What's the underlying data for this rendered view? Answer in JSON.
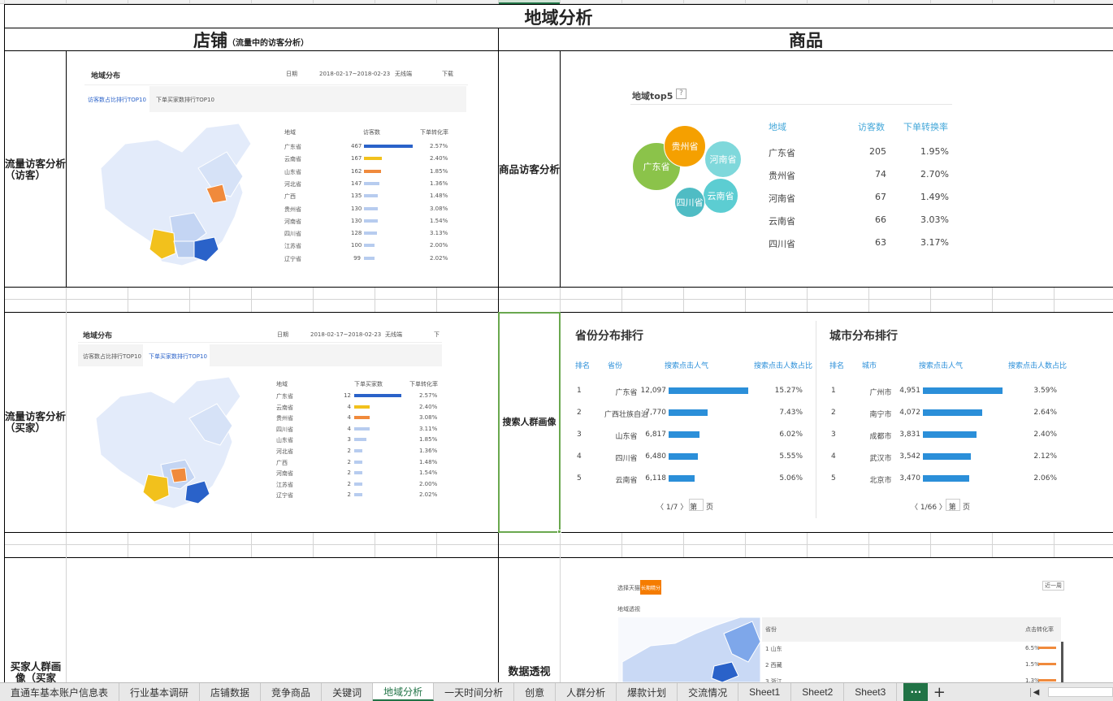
{
  "title": "地域分析",
  "headers": {
    "shop": "店铺",
    "shop_note": "（流量中的访客分析）",
    "product": "商品"
  },
  "row_labels": {
    "r1": "流量访客分析（访客）",
    "r2": "流量访客分析（买家）",
    "r3": "买家人群画像（买家",
    "p1": "商品访客分析",
    "p2": "搜索人群画像",
    "p3": "数据透视"
  },
  "shot1": {
    "title": "地域分布",
    "date_label": "日期",
    "date_range": "2018-02-17~2018-02-23",
    "device": "无线端",
    "download": "下载",
    "tabs": [
      "访客数占比排行TOP10",
      "下单买家数排行TOP10"
    ],
    "cols": [
      "地域",
      "访客数",
      "下单转化率"
    ],
    "rows": [
      {
        "name": "广东省",
        "v": "467",
        "r": "2.57%",
        "w": 1.0,
        "c": "#2a62c9"
      },
      {
        "name": "云南省",
        "v": "167",
        "r": "2.40%",
        "w": 0.36,
        "c": "#f2c11c"
      },
      {
        "name": "山东省",
        "v": "162",
        "r": "1.85%",
        "w": 0.35,
        "c": "#f08a3c"
      },
      {
        "name": "河北省",
        "v": "147",
        "r": "1.36%",
        "w": 0.31,
        "c": "#b7ccef"
      },
      {
        "name": "广西",
        "v": "135",
        "r": "1.48%",
        "w": 0.29,
        "c": "#b7ccef"
      },
      {
        "name": "贵州省",
        "v": "130",
        "r": "3.08%",
        "w": 0.28,
        "c": "#b7ccef"
      },
      {
        "name": "河南省",
        "v": "130",
        "r": "1.54%",
        "w": 0.28,
        "c": "#b7ccef"
      },
      {
        "name": "四川省",
        "v": "128",
        "r": "3.13%",
        "w": 0.27,
        "c": "#b7ccef"
      },
      {
        "name": "江苏省",
        "v": "100",
        "r": "2.00%",
        "w": 0.21,
        "c": "#b7ccef"
      },
      {
        "name": "辽宁省",
        "v": "99",
        "r": "2.02%",
        "w": 0.21,
        "c": "#b7ccef"
      }
    ]
  },
  "shot2": {
    "title": "地域分布",
    "date_label": "日期",
    "date_range": "2018-02-17~2018-02-23",
    "device": "无线端",
    "download": "下",
    "tabs": [
      "访客数占比排行TOP10",
      "下单买家数排行TOP10"
    ],
    "cols": [
      "地域",
      "下单买家数",
      "下单转化率"
    ],
    "rows": [
      {
        "name": "广东省",
        "v": "12",
        "r": "2.57%",
        "w": 1.0,
        "c": "#2a62c9"
      },
      {
        "name": "云南省",
        "v": "4",
        "r": "2.40%",
        "w": 0.33,
        "c": "#f2c11c"
      },
      {
        "name": "贵州省",
        "v": "4",
        "r": "3.08%",
        "w": 0.33,
        "c": "#f08a3c"
      },
      {
        "name": "四川省",
        "v": "4",
        "r": "3.11%",
        "w": 0.33,
        "c": "#b7ccef"
      },
      {
        "name": "山东省",
        "v": "3",
        "r": "1.85%",
        "w": 0.25,
        "c": "#b7ccef"
      },
      {
        "name": "河北省",
        "v": "2",
        "r": "1.36%",
        "w": 0.17,
        "c": "#b7ccef"
      },
      {
        "name": "广西",
        "v": "2",
        "r": "1.48%",
        "w": 0.17,
        "c": "#b7ccef"
      },
      {
        "name": "河南省",
        "v": "2",
        "r": "1.54%",
        "w": 0.17,
        "c": "#b7ccef"
      },
      {
        "name": "江苏省",
        "v": "2",
        "r": "2.00%",
        "w": 0.17,
        "c": "#b7ccef"
      },
      {
        "name": "辽宁省",
        "v": "2",
        "r": "2.02%",
        "w": 0.17,
        "c": "#b7ccef"
      }
    ]
  },
  "top5": {
    "title": "地域top5",
    "help": "?",
    "cols": [
      "地域",
      "访客数",
      "下单转换率"
    ],
    "rows": [
      {
        "name": "广东省",
        "v": "205",
        "r": "1.95%",
        "c": "#8bc34a"
      },
      {
        "name": "贵州省",
        "v": "74",
        "r": "2.70%",
        "c": "#f5a000"
      },
      {
        "name": "河南省",
        "v": "67",
        "r": "1.49%",
        "c": "#7fd8db"
      },
      {
        "name": "云南省",
        "v": "66",
        "r": "3.03%",
        "c": "#5ccdd2"
      },
      {
        "name": "四川省",
        "v": "63",
        "r": "3.17%",
        "c": "#4fbcc4"
      }
    ]
  },
  "province_rank": {
    "title": "省份分布排行",
    "cols": [
      "排名",
      "省份",
      "搜索点击人气",
      "搜索点击人数占比"
    ],
    "rows": [
      {
        "rank": "1",
        "name": "广东省",
        "v": "12,097",
        "p": "15.27%",
        "w": 1.0
      },
      {
        "rank": "2",
        "name": "广西壮族自治",
        "v": "7,770",
        "p": "7.43%",
        "w": 0.49
      },
      {
        "rank": "3",
        "name": "山东省",
        "v": "6,817",
        "p": "6.02%",
        "w": 0.39
      },
      {
        "rank": "4",
        "name": "四川省",
        "v": "6,480",
        "p": "5.55%",
        "w": 0.37
      },
      {
        "rank": "5",
        "name": "云南省",
        "v": "6,118",
        "p": "5.06%",
        "w": 0.33
      }
    ],
    "pager": "〈 1/7 〉 第",
    "page_suffix": "页"
  },
  "city_rank": {
    "title": "城市分布排行",
    "cols": [
      "排名",
      "城市",
      "搜索点击人气",
      "搜索点击人数占比"
    ],
    "rows": [
      {
        "rank": "1",
        "name": "广州市",
        "v": "4,951",
        "p": "3.59%",
        "w": 1.0
      },
      {
        "rank": "2",
        "name": "南宁市",
        "v": "4,072",
        "p": "2.64%",
        "w": 0.74
      },
      {
        "rank": "3",
        "name": "成都市",
        "v": "3,831",
        "p": "2.40%",
        "w": 0.67
      },
      {
        "rank": "4",
        "name": "武汉市",
        "v": "3,542",
        "p": "2.12%",
        "w": 0.6
      },
      {
        "rank": "5",
        "name": "北京市",
        "v": "3,470",
        "p": "2.06%",
        "w": 0.58
      }
    ],
    "pager": "〈 1/66 〉 第",
    "page_suffix": "页"
  },
  "pivot": {
    "btn1": "选择天猫",
    "btn2": "长期精分",
    "select": "近一周",
    "label": "地域透视",
    "col1": "省份",
    "col2": "点击转化率",
    "rows": [
      {
        "name": "1 山东",
        "p": "6.5%"
      },
      {
        "name": "2 西藏",
        "p": "1.5%"
      },
      {
        "name": "3 浙江",
        "p": "1.3%"
      }
    ]
  },
  "tabs": [
    "直通车基本账户信息表",
    "行业基本调研",
    "店铺数据",
    "竞争商品",
    "关键词",
    "地域分析",
    "一天时间分析",
    "创意",
    "人群分析",
    "爆款计划",
    "交流情况",
    "Sheet1",
    "Sheet2",
    "Sheet3"
  ],
  "active_tab": "地域分析",
  "more_tabs": "···",
  "add_sheet": "+",
  "colors": {
    "accent_green": "#217346",
    "bar_blue": "#2b8fd9",
    "selection_green": "#6aa84f"
  }
}
